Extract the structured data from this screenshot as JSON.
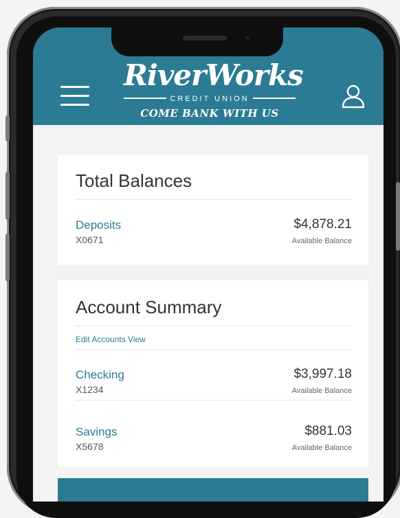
{
  "header": {
    "brand_name": "RiverWorks",
    "brand_sub": "CREDIT UNION",
    "tagline": "COME BANK WITH US",
    "brand_color": "#2b7b94",
    "menu_icon": "hamburger-icon",
    "user_icon": "user-icon"
  },
  "total_balances": {
    "title": "Total Balances",
    "accounts": [
      {
        "name": "Deposits",
        "number": "X0671",
        "balance": "$4,878.21",
        "balance_label": "Available Balance"
      }
    ]
  },
  "account_summary": {
    "title": "Account Summary",
    "edit_link": "Edit Accounts View",
    "accounts": [
      {
        "name": "Checking",
        "number": "X1234",
        "balance": "$3,997.18",
        "balance_label": "Available Balance"
      },
      {
        "name": "Savings",
        "number": "X5678",
        "balance": "$881.03",
        "balance_label": "Available Balance"
      }
    ]
  }
}
